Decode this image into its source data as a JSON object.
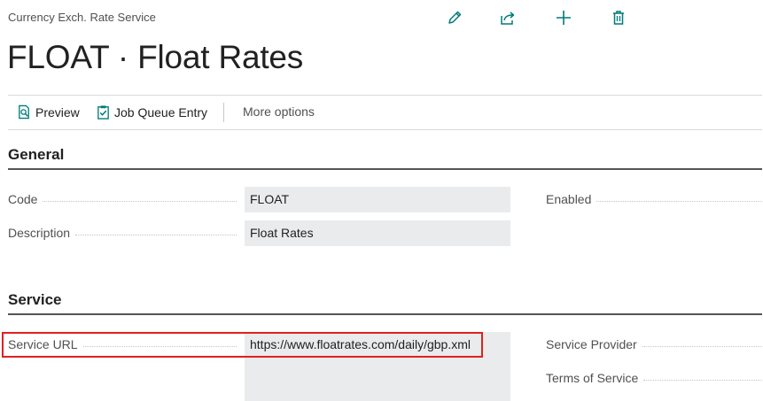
{
  "breadcrumb": "Currency Exch. Rate Service",
  "title": "FLOAT · Float Rates",
  "top_actions": [
    "pencil-icon",
    "share-icon",
    "plus-icon",
    "trash-icon"
  ],
  "accent_color": "#007a7a",
  "toolbar": {
    "preview_label": "Preview",
    "job_queue_label": "Job Queue Entry",
    "more_options_label": "More options"
  },
  "general": {
    "title": "General",
    "code_label": "Code",
    "code_value": "FLOAT",
    "description_label": "Description",
    "description_value": "Float Rates",
    "enabled_label": "Enabled"
  },
  "service": {
    "title": "Service",
    "url_label": "Service URL",
    "url_value": "https://www.floatrates.com/daily/gbp.xml",
    "provider_label": "Service Provider",
    "terms_label": "Terms of Service"
  }
}
